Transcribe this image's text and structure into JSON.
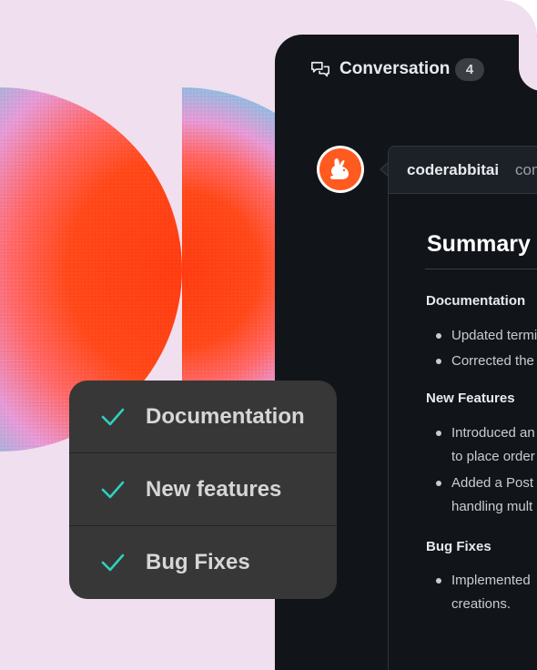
{
  "colors": {
    "background": "#f0dfee",
    "panel": "#111418",
    "card": "#373737",
    "accent_check": "#2fd1c0",
    "avatar_orange": "#ff5a1f"
  },
  "panel": {
    "tab_icon": "conversation-icon",
    "tab_label": "Conversation",
    "tab_count": "4"
  },
  "comment": {
    "avatar_icon": "rabbit-icon",
    "author": "coderabbitai",
    "action": "commented",
    "summary_title": "Summary",
    "sections": [
      {
        "heading": "Documentation",
        "lines": [
          "Updated terminology",
          "Corrected the"
        ]
      },
      {
        "heading": "New Features",
        "lines": [
          "Introduced an",
          "to place order",
          "Added a Post",
          "handling mult"
        ]
      },
      {
        "heading": "Bug Fixes",
        "lines": [
          "Implemented",
          "creations."
        ]
      }
    ]
  },
  "checklist": {
    "icon": "checkmark-icon",
    "items": [
      {
        "label": "Documentation"
      },
      {
        "label": "New features"
      },
      {
        "label": "Bug Fixes"
      }
    ]
  }
}
